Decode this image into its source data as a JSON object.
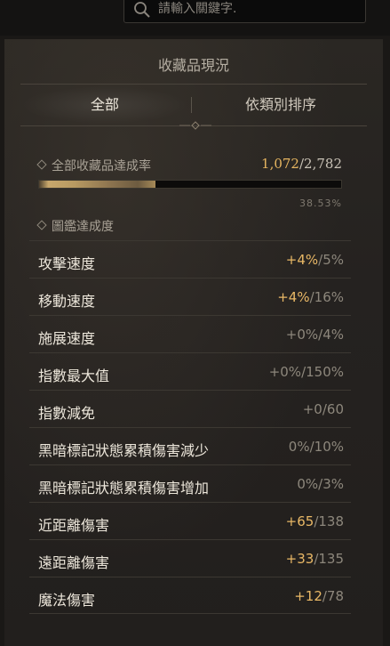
{
  "search": {
    "placeholder": "請輸入關鍵字."
  },
  "panel": {
    "title": "收藏品現況",
    "tabs": [
      {
        "label": "全部",
        "active": true
      },
      {
        "label": "依類別排序",
        "active": false
      }
    ],
    "completion": {
      "label": "全部收藏品達成率",
      "current": "1,072",
      "separator": "/",
      "total": "2,782",
      "percent_text": "38.53%",
      "percent": 38.53
    },
    "codex_label": "圖鑑達成度",
    "stats": [
      {
        "name": "攻擊速度",
        "bonus": "+4%",
        "max": "/5%",
        "highlight": true
      },
      {
        "name": "移動速度",
        "bonus": "+4%",
        "max": "/16%",
        "highlight": true
      },
      {
        "name": "施展速度",
        "bonus": "+0%",
        "max": "/4%",
        "highlight": false
      },
      {
        "name": "指數最大值",
        "bonus": "+0%",
        "max": "/150%",
        "highlight": false
      },
      {
        "name": "指數減免",
        "bonus": "+0",
        "max": "/60",
        "highlight": false
      },
      {
        "name": "黑暗標記狀態累積傷害減少",
        "bonus": "0%",
        "max": "/10%",
        "highlight": false
      },
      {
        "name": "黑暗標記狀態累積傷害增加",
        "bonus": "0%",
        "max": "/3%",
        "highlight": false
      },
      {
        "name": "近距離傷害",
        "bonus": "+65",
        "max": "/138",
        "highlight": true
      },
      {
        "name": "遠距離傷害",
        "bonus": "+33",
        "max": "/135",
        "highlight": true
      },
      {
        "name": "魔法傷害",
        "bonus": "+12",
        "max": "/78",
        "highlight": true
      }
    ]
  },
  "colors": {
    "accent": "#e6b560",
    "text": "#ece6da",
    "muted": "#8d877c"
  }
}
